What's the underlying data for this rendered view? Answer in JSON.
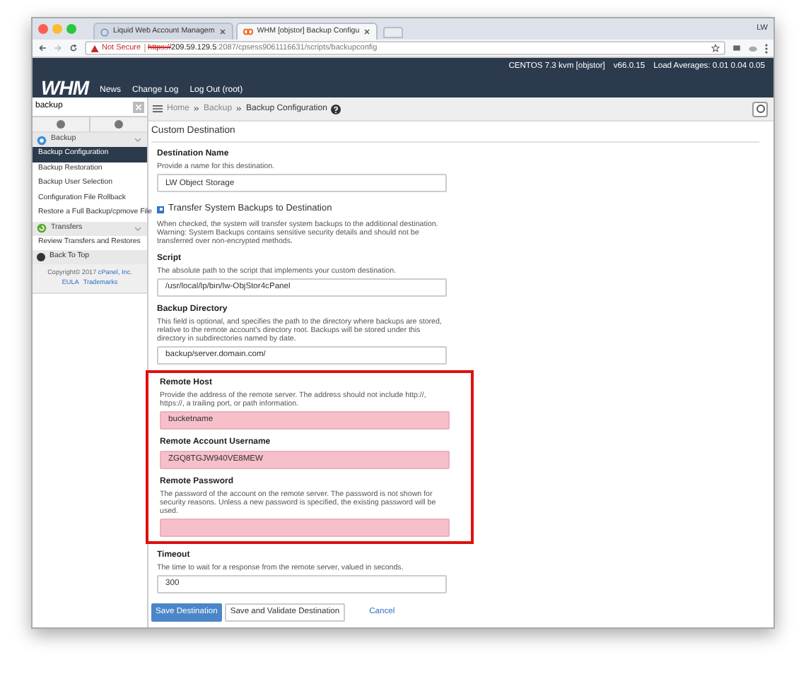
{
  "browser": {
    "tabs": [
      {
        "title": "Liquid Web Account Managem",
        "selected": false,
        "kind": "globe"
      },
      {
        "title": "WHM [objstor] Backup Configu",
        "selected": true,
        "kind": "cpanel"
      }
    ],
    "profile": "LW",
    "address": {
      "warning": "Not Secure",
      "protocol": "https://",
      "host": "209.59.129.5",
      "path": ":2087/cpsess9061116631/scripts/backupconfig"
    }
  },
  "header": {
    "logo": "WHM",
    "status": [
      "CENTOS 7.3 kvm [objstor]",
      "v66.0.15",
      "Load Averages: 0.01 0.04 0.05"
    ],
    "nav": [
      "News",
      "Change Log",
      "Log Out (root)"
    ]
  },
  "sidebar": {
    "search": "backup",
    "groups": [
      {
        "title": "Backup",
        "kind": "backup",
        "items": [
          {
            "label": "Backup Configuration",
            "selected": true
          },
          {
            "label": "Backup Restoration",
            "selected": false
          },
          {
            "label": "Backup User Selection",
            "selected": false
          },
          {
            "label": "Configuration File Rollback",
            "selected": false
          },
          {
            "label": "Restore a Full Backup/cpmove File",
            "selected": false
          }
        ]
      },
      {
        "title": "Transfers",
        "kind": "transfers",
        "items": [
          {
            "label": "Review Transfers and Restores",
            "selected": false
          }
        ]
      }
    ],
    "back_to_top": "Back To Top",
    "copyright": "Copyright© 2017",
    "company_link": "cPanel, Inc.",
    "links": [
      "EULA",
      "Trademarks"
    ]
  },
  "breadcrumb": [
    "Home",
    "Backup",
    "Backup Configuration"
  ],
  "form": {
    "title": "Custom Destination",
    "groups": [
      {
        "outlined": false,
        "fields": [
          {
            "kind": "text",
            "label": "Destination Name",
            "description": "Provide a name for this destination.",
            "value": "LW Object Storage",
            "invalid": false
          },
          {
            "kind": "checkbox",
            "label": "Transfer System Backups to Destination",
            "checked": true,
            "description": "When checked, the system will transfer system backups to the additional destination. Warning: System Backups contains sensitive security details and should not be transferred over non-encrypted methods."
          },
          {
            "kind": "text",
            "label": "Script",
            "description": "The absolute path to the script that implements your custom destination.",
            "value": "/usr/local/lp/bin/lw-ObjStor4cPanel",
            "invalid": false
          },
          {
            "kind": "text",
            "label": "Backup Directory",
            "description": "This field is optional, and specifies the path to the directory where backups are stored, relative to the remote account's directory root. Backups will be stored under this directory in subdirectories named by date.",
            "value": "backup/server.domain.com/",
            "invalid": false
          }
        ]
      },
      {
        "outlined": true,
        "fields": [
          {
            "kind": "text",
            "label": "Remote Host",
            "description": "Provide the address of the remote server. The address should not include http://, https://, a trailing port, or path information.",
            "value": "bucketname",
            "invalid": true
          },
          {
            "kind": "text",
            "label": "Remote Account Username",
            "value": "ZGQ8TGJW940VE8MEW",
            "invalid": true
          },
          {
            "kind": "text",
            "label": "Remote Password",
            "description": "The password of the account on the remote server. The password is not shown for security reasons. Unless a new password is specified, the existing password will be used.",
            "invalid": true
          }
        ]
      },
      {
        "outlined": false,
        "fields": [
          {
            "kind": "text",
            "label": "Timeout",
            "description": "The time to wait for a response from the remote server, valued in seconds.",
            "value": "300",
            "invalid": false
          }
        ]
      }
    ],
    "buttons": [
      {
        "label": "Save Destination",
        "kind": "primary"
      },
      {
        "label": "Save and Validate Destination",
        "kind": "secondary"
      },
      {
        "label": "Cancel",
        "kind": "link"
      }
    ]
  }
}
